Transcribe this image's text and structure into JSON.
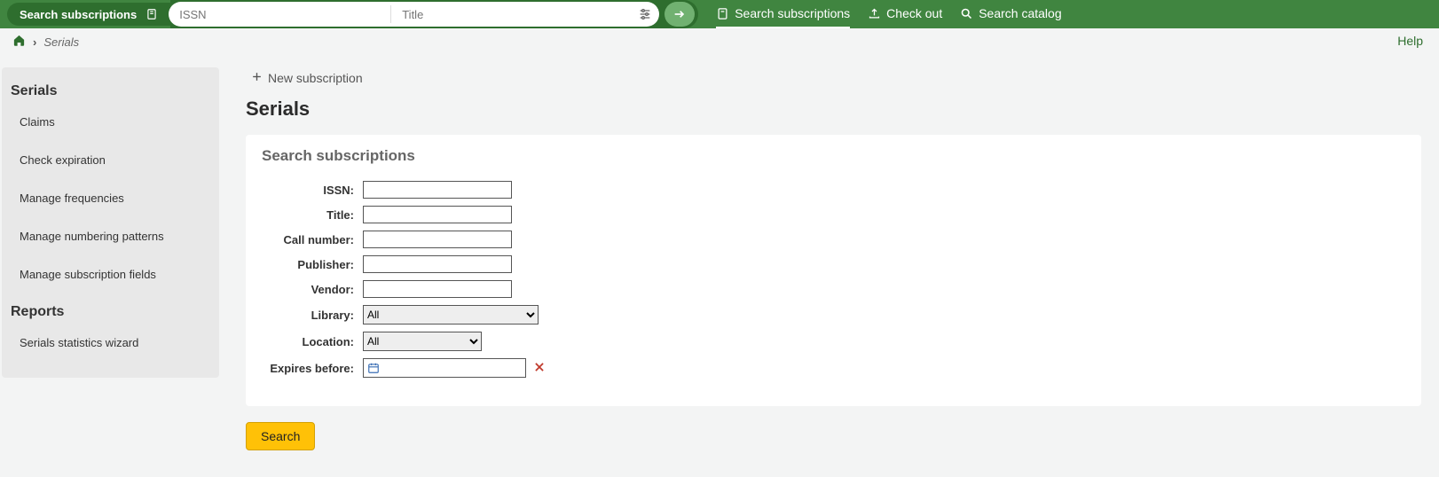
{
  "topbar": {
    "pill_label": "Search subscriptions",
    "issn_placeholder": "ISSN",
    "title_placeholder": "Title",
    "nav": {
      "search_subscriptions": "Search subscriptions",
      "check_out": "Check out",
      "search_catalog": "Search catalog"
    }
  },
  "breadcrumb": {
    "current": "Serials"
  },
  "help_label": "Help",
  "sidebar": {
    "serials_heading": "Serials",
    "claims": "Claims",
    "check_expiration": "Check expiration",
    "manage_frequencies": "Manage frequencies",
    "manage_numbering": "Manage numbering patterns",
    "manage_subscription_fields": "Manage subscription fields",
    "reports_heading": "Reports",
    "serials_stats": "Serials statistics wizard"
  },
  "toolbar": {
    "new_subscription": "New subscription"
  },
  "page": {
    "title": "Serials",
    "card_title": "Search subscriptions"
  },
  "form": {
    "issn_label": "ISSN:",
    "title_label": "Title:",
    "callnumber_label": "Call number:",
    "publisher_label": "Publisher:",
    "vendor_label": "Vendor:",
    "library_label": "Library:",
    "library_value": "All",
    "location_label": "Location:",
    "location_value": "All",
    "expires_label": "Expires before:",
    "search_button": "Search"
  }
}
